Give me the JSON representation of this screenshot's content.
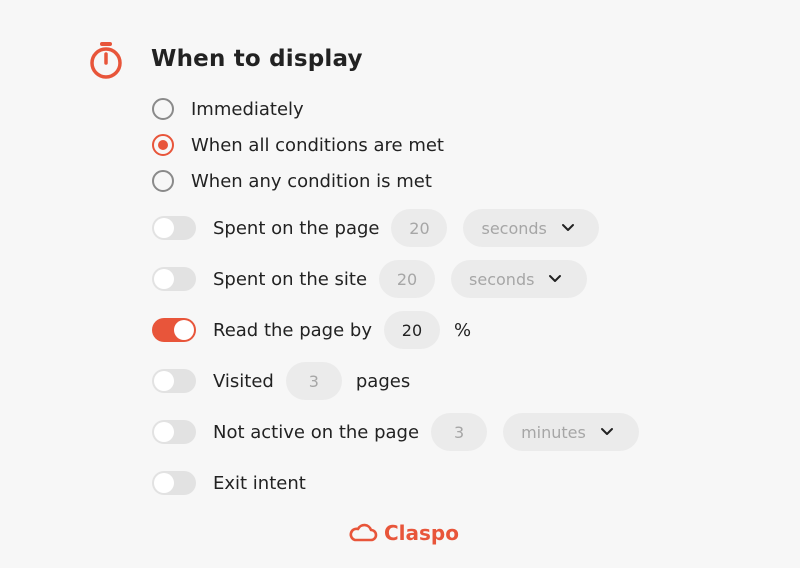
{
  "section": {
    "title": "When to display"
  },
  "display_mode": {
    "selected": "all",
    "options": [
      {
        "id": "immediately",
        "label": "Immediately",
        "checked": false
      },
      {
        "id": "all",
        "label": "When all conditions are met",
        "checked": true
      },
      {
        "id": "any",
        "label": "When any condition is met",
        "checked": false
      }
    ]
  },
  "conditions": [
    {
      "label": "Spent on the page",
      "enabled": false,
      "value": "20",
      "unit": "seconds"
    },
    {
      "label": "Spent on the site",
      "enabled": false,
      "value": "20",
      "unit": "seconds"
    },
    {
      "label": "Read the page by",
      "enabled": true,
      "value": "20",
      "suffix": "%"
    },
    {
      "label": "Visited",
      "enabled": false,
      "value": "3",
      "suffix": "pages"
    },
    {
      "label": "Not active on the page",
      "enabled": false,
      "value": "3",
      "unit": "minutes"
    },
    {
      "label": "Exit intent",
      "enabled": false
    }
  ],
  "brand": {
    "name": "Claspo"
  },
  "colors": {
    "accent": "#e8553a",
    "toggle_off": "#e2e2e2",
    "field_bg": "#ebebeb"
  },
  "icons": {
    "header": "stopwatch-icon",
    "brand": "cloud-logo-icon",
    "dropdown": "chevron-down-icon"
  }
}
